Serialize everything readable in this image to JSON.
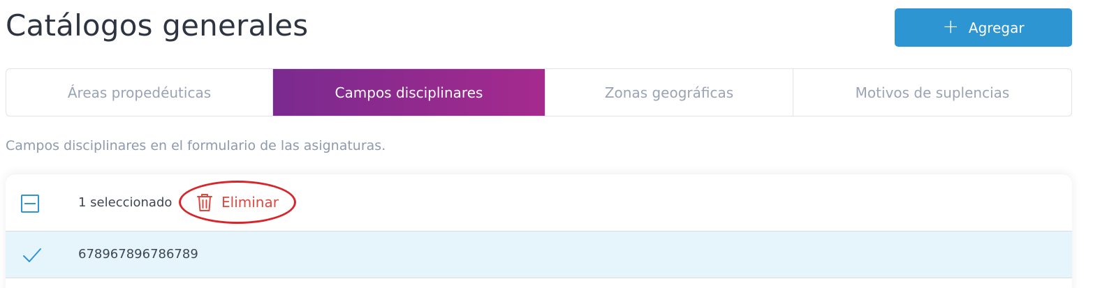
{
  "header": {
    "title": "Catálogos generales",
    "add_label": "Agregar"
  },
  "tabs": [
    {
      "label": "Áreas propedéuticas",
      "active": false
    },
    {
      "label": "Campos disciplinares",
      "active": true
    },
    {
      "label": "Zonas geográficas",
      "active": false
    },
    {
      "label": "Motivos de suplencias",
      "active": false
    }
  ],
  "description": "Campos disciplinares en el formulario de las asignaturas.",
  "table": {
    "selected_text": "1 seleccionado",
    "delete_label": "Eliminar",
    "rows": [
      {
        "value": "678967896786789",
        "selected": true
      }
    ]
  },
  "colors": {
    "primary": "#2e95d3",
    "tab_gradient_start": "#7a2a8f",
    "tab_gradient_end": "#a52a8e",
    "danger": "#e0473d",
    "annotation_ring": "#d9252a",
    "selected_row_bg": "#e6f5fc"
  },
  "icons": {
    "add": "plus-icon",
    "delete": "trash-icon",
    "select_all": "indeterminate-checkbox-icon",
    "row_selected": "checkmark-icon"
  }
}
